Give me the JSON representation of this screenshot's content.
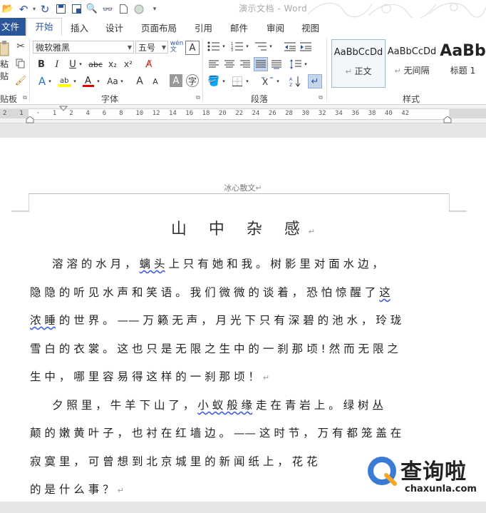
{
  "window": {
    "title": "演示文档 - Word"
  },
  "tabs": {
    "file": "文件",
    "items": [
      "开始",
      "插入",
      "设计",
      "页面布局",
      "引用",
      "邮件",
      "审阅",
      "视图"
    ],
    "active": "开始"
  },
  "ribbon": {
    "clipboard": {
      "paste_label": "粘贴",
      "group_label": "贴板"
    },
    "font": {
      "font_name": "微软雅黑",
      "font_size": "五号",
      "bold": "B",
      "italic": "I",
      "underline": "U",
      "strike": "abc",
      "subscript": "x₂",
      "superscript": "x²",
      "case": "Aa",
      "grow": "A",
      "shrink": "A",
      "group_label": "字体"
    },
    "paragraph": {
      "group_label": "段落"
    },
    "styles": {
      "items": [
        {
          "preview": "AaBbCcDd",
          "name": "正文"
        },
        {
          "preview": "AaBbCcDd",
          "name": "无间隔"
        },
        {
          "preview": "AaBb",
          "name": "标题 1"
        }
      ],
      "group_label": "样式"
    }
  },
  "ruler": {
    "ticks": [
      "2",
      "1",
      "",
      "1",
      "2",
      "4",
      "6",
      "8",
      "10",
      "12",
      "14",
      "16",
      "18",
      "20",
      "22",
      "24",
      "26",
      "28",
      "30",
      "32",
      "34",
      "36",
      "38",
      "40",
      "42"
    ]
  },
  "document": {
    "header": "冰心散文",
    "title": "山 中 杂 感",
    "paragraph_mark": "↵",
    "lines": [
      "　　溶 溶 的 水 月 ， 螭 头 上 只 有 她 和 我 。 树 影 里 对 面 水 边 ，",
      "隐 隐 的 听 见 水 声 和 笑 语 。 我 们 微 微 的 谈 着 ， 恐 怕 惊 醒 了 这",
      "浓 睡 的 世 界 。 —— 万 籁 无 声 ， 月 光 下 只 有 深 碧 的 池 水 ， 玲 珑",
      "雪 白 的 衣 裳 。 这 也 只 是 无 限 之 生 中 的 一 刹 那 顷 ! 然 而 无 限 之",
      "生 中 ， 哪 里 容 易 得 这 样 的 一 刹 那 顷 ！",
      "　　夕 照 里 ， 牛 羊 下 山 了 ， 小 蚁 般 缘 走 在 青 岩 上 。 绿 树 丛",
      "颠 的 嫩 黄 叶 子 ， 也 衬 在 红 墙 边 。 —— 这 时 节 ， 万 有 都 笼 盖 在",
      "寂 寞 里 ， 可 曾 想 到 北 京 城 里 的 新 闻 纸 上 ， 花 花",
      "的 是 什 么 事 ？"
    ]
  },
  "watermark_logo": {
    "text": "查询啦",
    "url": "chaxunla.com"
  }
}
